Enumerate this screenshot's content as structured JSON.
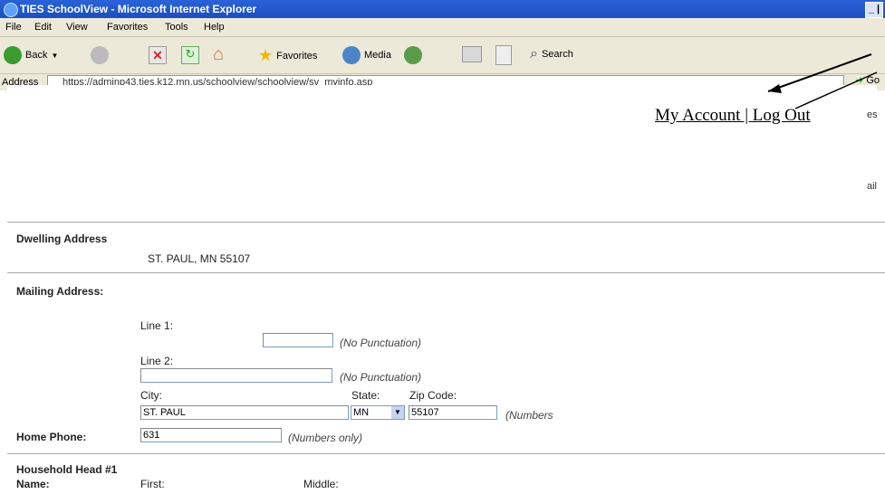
{
  "window": {
    "title": "TIES SchoolView - Microsoft Internet Explorer",
    "controls": "_ | é"
  },
  "menu": [
    "File",
    "Edit",
    "View",
    "Favorites",
    "Tools",
    "Help"
  ],
  "toolbar": {
    "back": "Back",
    "favorites": "Favorites",
    "media": "Media",
    "search": "Search"
  },
  "address": {
    "label": "Address",
    "url": "https://adminp43.ties.k12.mn.us/schoolview/schoolview/sv_myinfo.asp",
    "go": "Go"
  },
  "account": {
    "link": "My Account | Log Out"
  },
  "fragments": {
    "right1": "es",
    "right2": "ail"
  },
  "dwelling": {
    "label": "Dwelling Address",
    "value": "ST. PAUL, MN 55107"
  },
  "mailing": {
    "label": "Mailing Address:",
    "line1_label": "Line 1:",
    "line1_value": "",
    "line1_hint": "(No Punctuation)",
    "line2_label": "Line 2:",
    "line2_value": "",
    "line2_hint": "(No Punctuation)",
    "city_label": "City:",
    "city_value": "ST. PAUL",
    "state_label": "State:",
    "state_value": "MN",
    "zip_label": "Zip Code:",
    "zip_value": "55107",
    "zip_hint": "(Numbers"
  },
  "phone": {
    "label": "Home Phone:",
    "value": "631",
    "hint": "(Numbers only)"
  },
  "household": {
    "label": "Household Head #1",
    "name_label": "Name:",
    "first_label": "First:",
    "middle_label": "Middle:"
  }
}
